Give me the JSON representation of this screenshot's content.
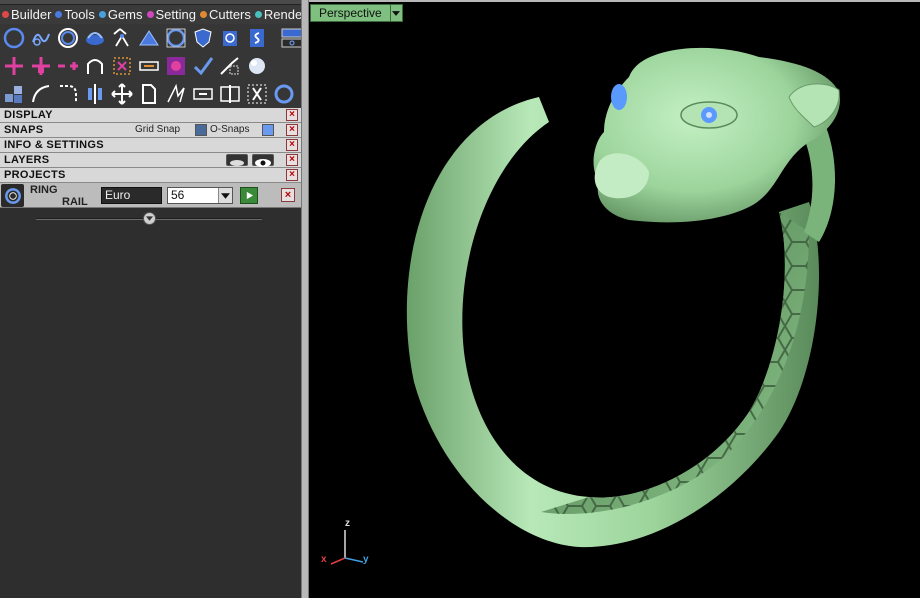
{
  "menus": [
    {
      "label": "Builder",
      "color": "#e04848"
    },
    {
      "label": "Tools",
      "color": "#4a7ae0"
    },
    {
      "label": "Gems",
      "color": "#48a0e0"
    },
    {
      "label": "Setting",
      "color": "#d048c0"
    },
    {
      "label": "Cutters",
      "color": "#e08a30"
    },
    {
      "label": "Render",
      "color": "#48c0c0"
    }
  ],
  "panels": {
    "display": "DISPLAY",
    "snaps": "SNAPS",
    "snaps_grid": "Grid Snap",
    "snaps_osnaps": "O-Snaps",
    "info": "INFO & SETTINGS",
    "layers": "LAYERS",
    "projects": "PROJECTS",
    "close": "×"
  },
  "ring_builder": {
    "label_line1": "RING",
    "label_line2": "RAIL",
    "standard": "Euro",
    "size": "56"
  },
  "viewport": {
    "label": "Perspective",
    "axis_x": "x",
    "axis_y": "y",
    "axis_z": "z",
    "model_color": "#9cd49c",
    "eye_color": "#5a9aff"
  },
  "icons": [
    "circle-icon",
    "curve-icon",
    "ring-icon",
    "shape-icon",
    "gem-icon",
    "mountain-icon",
    "frame-icon",
    "shield-icon",
    "cup-icon",
    "spiral-icon",
    "add-point-icon",
    "add-node-icon",
    "plus-minus-icon",
    "arc-icon",
    "grid-delete-icon",
    "link-icon",
    "pattern-icon",
    "check-icon",
    "knife-icon",
    "sphere-icon",
    "cubes-icon",
    "arc-tool-icon",
    "fillet-icon",
    "mirror-icon",
    "move-icon",
    "paste-icon",
    "spark-icon",
    "chain-icon",
    "split-icon",
    "cut-icon"
  ]
}
